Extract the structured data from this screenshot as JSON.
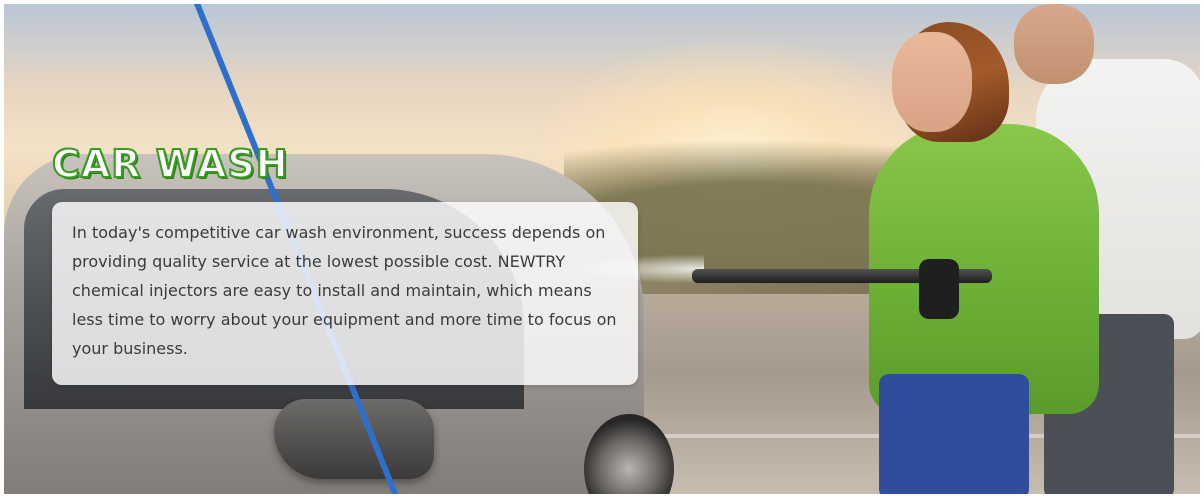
{
  "banner": {
    "title": "CAR WASH",
    "description": "In today's competitive car wash environment, success depends on providing quality service at the lowest possible cost. NEWTRY chemical injectors are easy to install and maintain, which means less time to worry about your equipment and more time to focus on your business.",
    "colors": {
      "title_fill": "#ffffff",
      "title_outline": "#3a9b22",
      "panel": "#ffffff",
      "text": "#3b3b3b"
    }
  }
}
